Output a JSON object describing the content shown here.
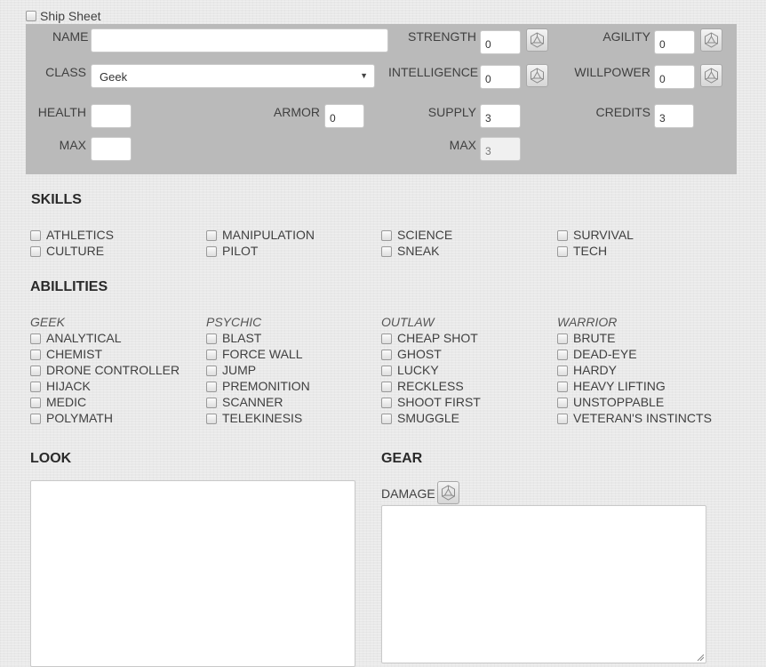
{
  "ship_sheet": {
    "label": "Ship Sheet"
  },
  "stats": {
    "name": {
      "label": "NAME",
      "value": ""
    },
    "class": {
      "label": "CLASS",
      "value": "Geek"
    },
    "strength": {
      "label": "STRENGTH",
      "value": "0"
    },
    "intelligence": {
      "label": "INTELLIGENCE",
      "value": "0"
    },
    "agility": {
      "label": "AGILITY",
      "value": "0"
    },
    "willpower": {
      "label": "WILLPOWER",
      "value": "0"
    },
    "health": {
      "label": "HEALTH",
      "value": "",
      "max_label": "MAX",
      "max_value": ""
    },
    "armor": {
      "label": "ARMOR",
      "value": "0"
    },
    "supply": {
      "label": "SUPPLY",
      "value": "3",
      "max_label": "MAX",
      "max_value": "3"
    },
    "credits": {
      "label": "CREDITS",
      "value": "3"
    }
  },
  "skills": {
    "title": "SKILLS",
    "items": [
      "ATHLETICS",
      "MANIPULATION",
      "SCIENCE",
      "SURVIVAL",
      "CULTURE",
      "PILOT",
      "SNEAK",
      "TECH"
    ]
  },
  "abilities": {
    "title": "ABILLITIES",
    "groups": [
      {
        "name": "GEEK",
        "items": [
          "ANALYTICAL",
          "CHEMIST",
          "DRONE CONTROLLER",
          "HIJACK",
          "MEDIC",
          "POLYMATH"
        ]
      },
      {
        "name": "PSYCHIC",
        "items": [
          "BLAST",
          "FORCE WALL",
          "JUMP",
          "PREMONITION",
          "SCANNER",
          "TELEKINESIS"
        ]
      },
      {
        "name": "OUTLAW",
        "items": [
          "CHEAP SHOT",
          "GHOST",
          "LUCKY",
          "RECKLESS",
          "SHOOT FIRST",
          "SMUGGLE"
        ]
      },
      {
        "name": "WARRIOR",
        "items": [
          "BRUTE",
          "DEAD-EYE",
          "HARDY",
          "HEAVY LIFTING",
          "UNSTOPPABLE",
          "VETERAN'S INSTINCTS"
        ]
      }
    ]
  },
  "look": {
    "title": "LOOK",
    "value": ""
  },
  "gear": {
    "title": "GEAR",
    "damage_label": "DAMAGE",
    "value": ""
  },
  "icons": {
    "roll": "d20-dice-icon",
    "select_arrow": "chevron-down-icon"
  }
}
